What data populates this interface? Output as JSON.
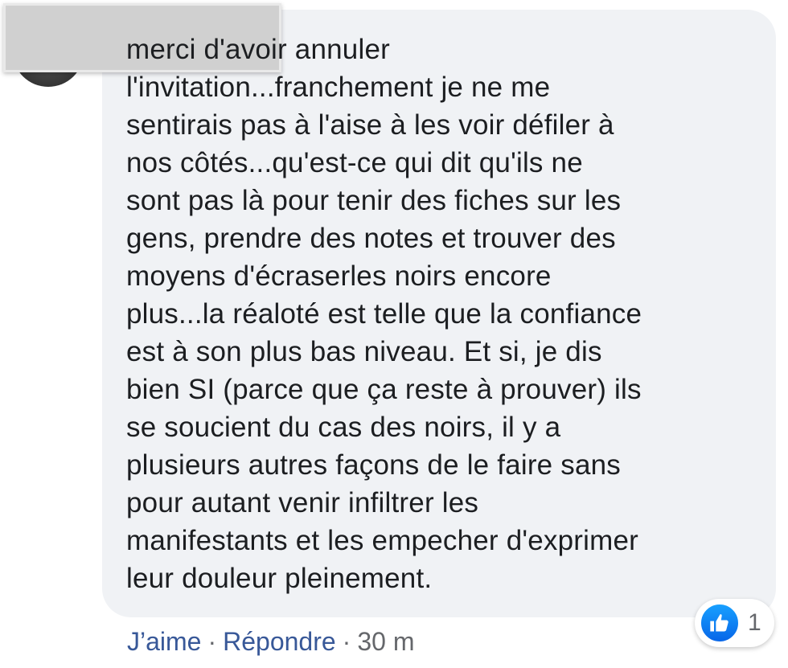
{
  "comment": {
    "text": "merci d'avoir annuler\nl'invitation...franchement je ne me\nsentirais pas à l'aise à les voir défiler à\nnos côtés...qu'est-ce qui dit qu'ils ne\nsont pas là pour tenir des fiches sur les\ngens, prendre des notes et trouver des\nmoyens d'écraserles noirs encore\nplus...la réaloté est telle que la confiance\nest à son plus bas niveau. Et si, je dis\nbien SI (parce que ça reste à prouver) ils\nse soucient du cas des noirs, il y a\nplusieurs autres façons de le faire sans\npour autant venir infiltrer les\nmanifestants et les empecher d'exprimer\nleur douleur pleinement.",
    "author_name_redacted": true
  },
  "actions": {
    "like_label": "J’aime",
    "reply_label": "Répondre",
    "separator": "·",
    "timestamp": "30 m"
  },
  "reactions": {
    "icon": "thumbs-up-icon",
    "count": "1",
    "color": "#1877f2"
  },
  "colors": {
    "bubble": "#f0f2f5",
    "link": "#385898",
    "meta": "#65676b",
    "text": "#1c1e21"
  }
}
